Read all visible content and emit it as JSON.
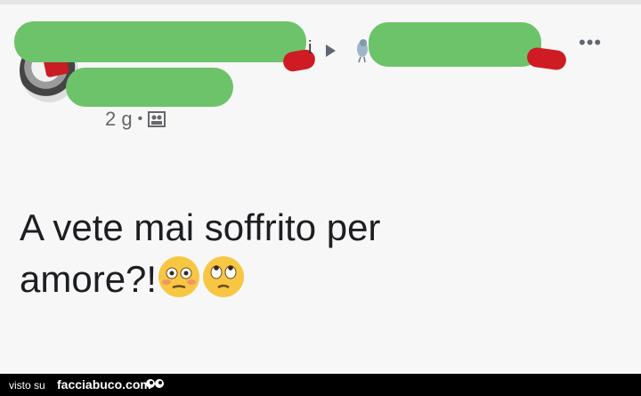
{
  "header": {
    "more_label": "•••",
    "name_tail": "i"
  },
  "meta": {
    "time": "2 g",
    "separator": "•",
    "audience_icon": "group-audience-icon"
  },
  "post": {
    "line1": "A vete mai soffrito per",
    "line2": "amore?!",
    "emojis": [
      "flushed-face-emoji",
      "face-with-rolling-eyes-emoji"
    ]
  },
  "footer": {
    "visto_label": "visto su",
    "site_label": "facciabuco.com"
  },
  "colors": {
    "redaction": "#6dc36a",
    "redaction_edge": "#cf1c24",
    "footer_bg": "#000000"
  }
}
